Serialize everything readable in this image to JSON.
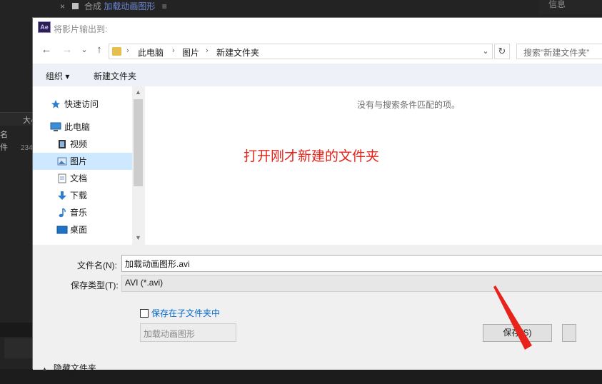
{
  "background_app": {
    "tab_label": "合成",
    "composition_name": "加载动画图形",
    "menu_glyph": "≡",
    "info_panel_title": "信息",
    "column_label": "大小",
    "row1_label": "名",
    "row2_label": "件",
    "row2_value": "234"
  },
  "dialog": {
    "title": "将影片输出到:",
    "app_badge": "Ae",
    "nav": {
      "back": "←",
      "forward": "→",
      "recent": "⌄",
      "up": "↑",
      "refresh": "↻",
      "dropdown": "⌄"
    },
    "breadcrumb": [
      "此电脑",
      "图片",
      "新建文件夹"
    ],
    "breadcrumb_sep": "›",
    "search_placeholder": "搜索\"新建文件夹\"",
    "toolbar": {
      "organize": "组织 ▾",
      "new_folder": "新建文件夹"
    },
    "sidebar": {
      "items": [
        {
          "label": "快速访问",
          "icon": "star-icon"
        },
        {
          "label": "此电脑",
          "icon": "computer-icon"
        },
        {
          "label": "视频",
          "icon": "video-icon"
        },
        {
          "label": "图片",
          "icon": "pictures-icon"
        },
        {
          "label": "文档",
          "icon": "document-icon"
        },
        {
          "label": "下载",
          "icon": "download-icon"
        },
        {
          "label": "音乐",
          "icon": "music-icon"
        },
        {
          "label": "桌面",
          "icon": "desktop-icon"
        }
      ],
      "selected_index": 3
    },
    "empty_message": "没有与搜索条件匹配的项。",
    "annotation": "打开刚才新建的文件夹",
    "filename_label": "文件名(N):",
    "filename_value": "加载动画图形.avi",
    "filetype_label": "保存类型(T):",
    "filetype_value": "AVI (*.avi)",
    "subfolder_checkbox_label": "保存在子文件夹中",
    "subfolder_value": "加载动画图形",
    "hide_folders_label": "隐藏文件夹",
    "save_button": "保存(S)"
  }
}
